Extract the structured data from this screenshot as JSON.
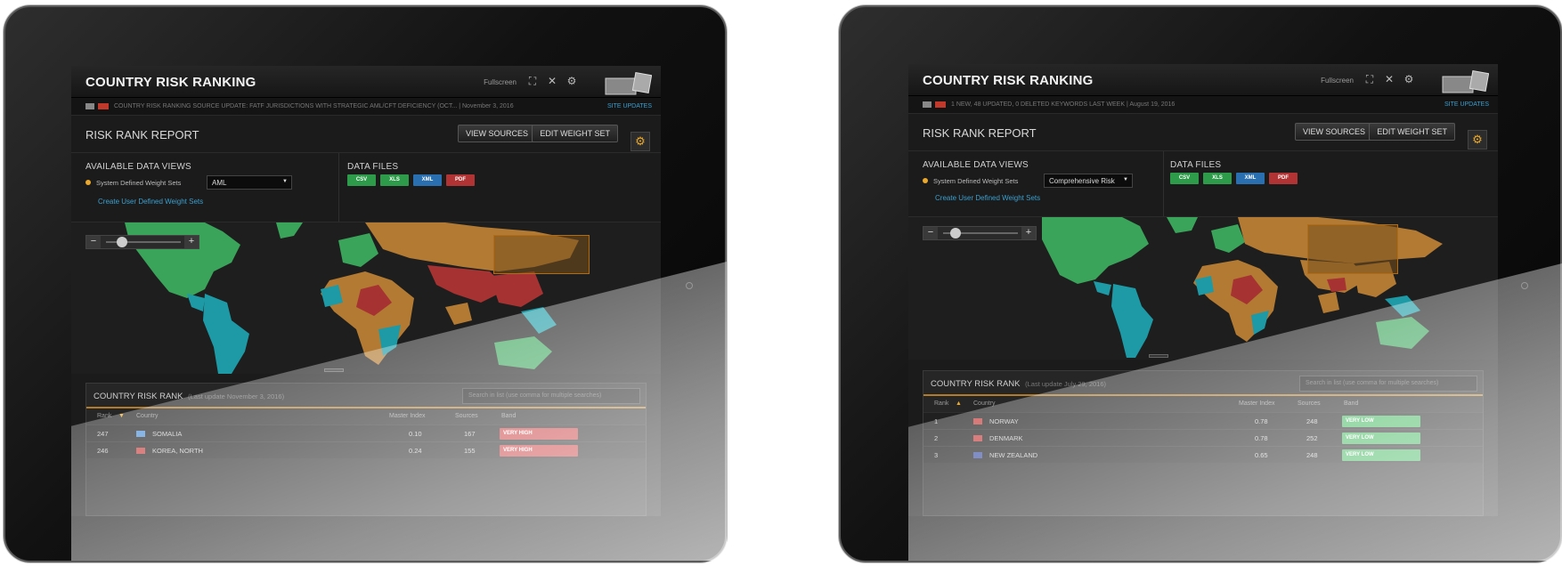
{
  "colors": {
    "accent": "#e8a92e",
    "link": "#3aa0d0",
    "band_very_high": "#c9383a",
    "band_very_low": "#3db65a",
    "map_green": "#3aa45a",
    "map_orange": "#b27a32",
    "map_red": "#a63232",
    "map_teal": "#1d9aa6"
  },
  "left": {
    "app_title": "COUNTRY RISK RANKING",
    "fullscreen_label": "Fullscreen",
    "ticker_text": "COUNTRY RISK RANKING SOURCE UPDATE: FATF JURISDICTIONS WITH STRATEGIC AML/CFT DEFICIENCY (OCT...   | November 3, 2016",
    "site_updates": "SITE UPDATES",
    "report_title": "RISK RANK REPORT",
    "view_sources": "VIEW SOURCES",
    "edit_weight_set": "EDIT WEIGHT SET",
    "available_views": "AVAILABLE DATA VIEWS",
    "system_weight_label": "System Defined Weight Sets",
    "selected_weight_set": "AML",
    "create_link": "Create User Defined Weight Sets",
    "data_files": "DATA FILES",
    "file_types": [
      "CSV",
      "XLS",
      "XML",
      "PDF"
    ],
    "rank_title": "COUNTRY RISK RANK",
    "rank_update": "(Last update November 3, 2016)",
    "search_placeholder": "Search in list (use comma for multiple searches)",
    "columns": [
      "Rank",
      "Country",
      "Master Index",
      "Sources",
      "Band"
    ],
    "rows": [
      {
        "rank": "247",
        "country": "SOMALIA",
        "index": "0.10",
        "sources": "167",
        "band": "VERY HIGH"
      },
      {
        "rank": "246",
        "country": "KOREA, NORTH",
        "index": "0.24",
        "sources": "155",
        "band": "VERY HIGH"
      }
    ]
  },
  "right": {
    "app_title": "COUNTRY RISK RANKING",
    "fullscreen_label": "Fullscreen",
    "ticker_text": "1 NEW, 48 UPDATED, 0 DELETED KEYWORDS LAST WEEK | August 19, 2016",
    "site_updates": "SITE UPDATES",
    "report_title": "RISK RANK REPORT",
    "view_sources": "VIEW SOURCES",
    "edit_weight_set": "EDIT WEIGHT SET",
    "available_views": "AVAILABLE DATA VIEWS",
    "system_weight_label": "System Defined Weight Sets",
    "selected_weight_set": "Comprehensive Risk",
    "create_link": "Create User Defined Weight Sets",
    "data_files": "DATA FILES",
    "file_types": [
      "CSV",
      "XLS",
      "XML",
      "PDF"
    ],
    "rank_title": "COUNTRY RISK RANK",
    "rank_update": "(Last update July 29, 2016)",
    "search_placeholder": "Search in list (use comma for multiple searches)",
    "columns": [
      "Rank",
      "Country",
      "Master Index",
      "Sources",
      "Band"
    ],
    "rows": [
      {
        "rank": "1",
        "country": "NORWAY",
        "index": "0.78",
        "sources": "248",
        "band": "VERY LOW"
      },
      {
        "rank": "2",
        "country": "DENMARK",
        "index": "0.78",
        "sources": "252",
        "band": "VERY LOW"
      },
      {
        "rank": "3",
        "country": "NEW ZEALAND",
        "index": "0.65",
        "sources": "248",
        "band": "VERY LOW"
      }
    ]
  }
}
